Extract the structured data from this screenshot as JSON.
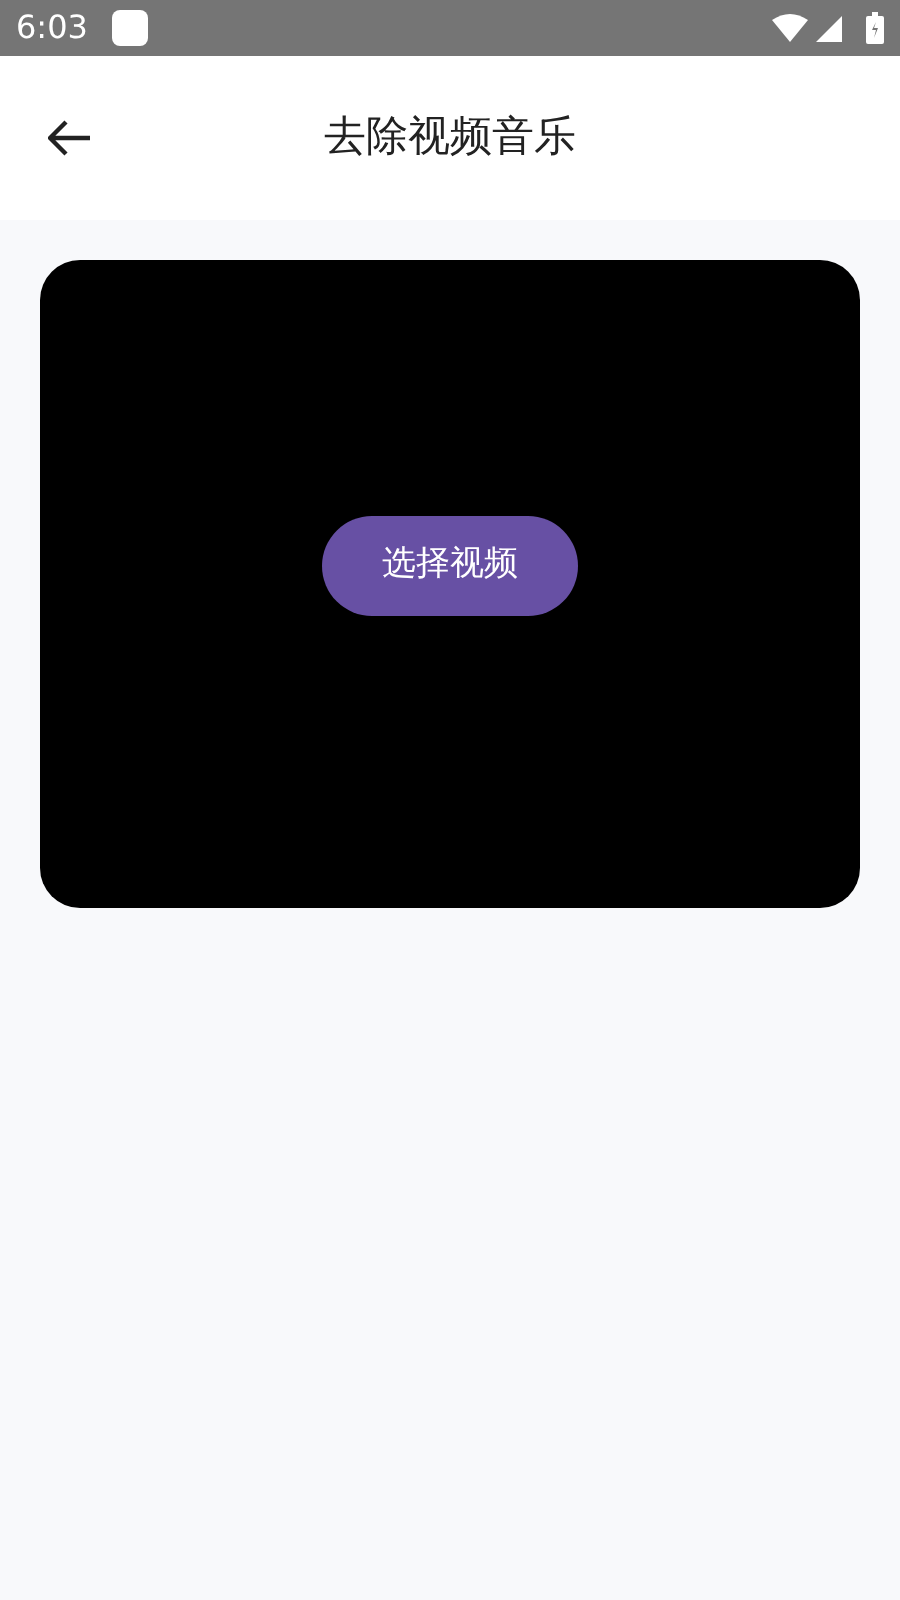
{
  "status_bar": {
    "time": "6:03"
  },
  "header": {
    "title": "去除视频音乐"
  },
  "video_panel": {
    "button": "选择视频"
  }
}
